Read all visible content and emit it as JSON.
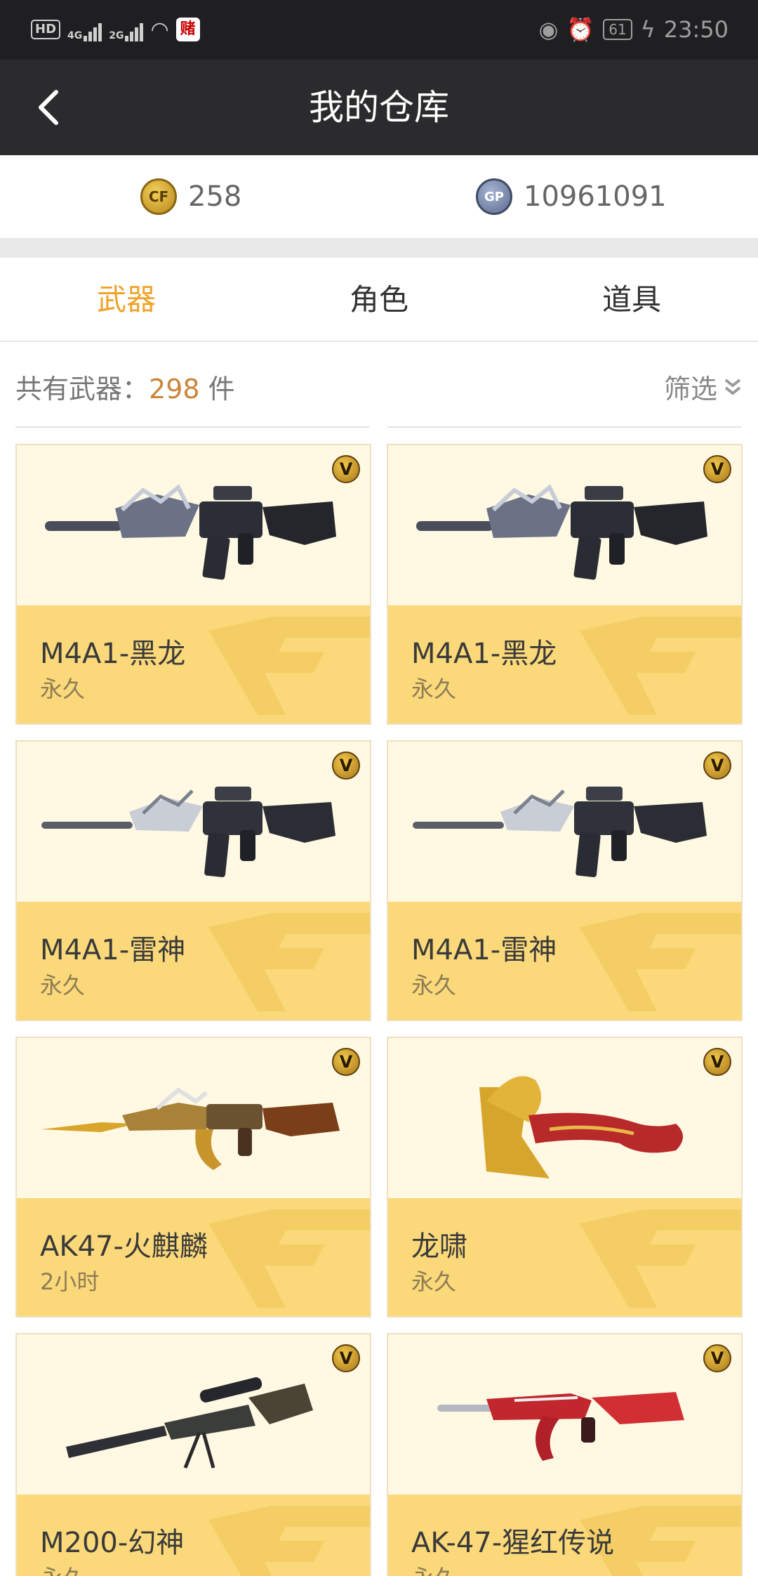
{
  "statusbar": {
    "hd": "HD",
    "sig1": "4G",
    "sig2": "2G",
    "app_icon": "赌",
    "battery": "61",
    "time": "23:50"
  },
  "header": {
    "title": "我的仓库",
    "back_icon": "chevron-left-icon"
  },
  "currency": {
    "cf_points": "258",
    "gp_points": "10961091",
    "cf_icon": "cf-coin-icon",
    "gp_icon": "gp-coin-icon",
    "gp_badge": "GP"
  },
  "tabs": [
    {
      "label": "武器",
      "active": true
    },
    {
      "label": "角色",
      "active": false
    },
    {
      "label": "道具",
      "active": false
    }
  ],
  "summary": {
    "prefix": "共有武器：",
    "count": "298",
    "suffix": " 件",
    "filter_label": "筛选"
  },
  "badge_letter": "V",
  "items": [
    {
      "name": "M4A1-黑龙",
      "duration": "永久",
      "icon": "rifle-image"
    },
    {
      "name": "M4A1-黑龙",
      "duration": "永久",
      "icon": "rifle-image"
    },
    {
      "name": "M4A1-雷神",
      "duration": "永久",
      "icon": "rifle-image"
    },
    {
      "name": "M4A1-雷神",
      "duration": "永久",
      "icon": "rifle-image"
    },
    {
      "name": "AK47-火麒麟",
      "duration": "2小时",
      "icon": "rifle-image"
    },
    {
      "name": "龙啸",
      "duration": "永久",
      "icon": "axe-image"
    },
    {
      "name": "M200-幻神",
      "duration": "永久",
      "icon": "sniper-rifle-image"
    },
    {
      "name": "AK-47-猩红传说",
      "duration": "永久",
      "icon": "rifle-image"
    }
  ],
  "colors": {
    "accent": "#f0a32a",
    "card_info": "#fbd97a",
    "card_image": "#fff8e2",
    "header": "#2b2b2e"
  }
}
